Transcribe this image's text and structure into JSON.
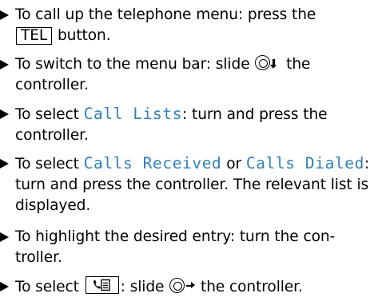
{
  "steps": [
    {
      "prefix": "To call up the telephone menu: press the ",
      "button_label": "TEL",
      "suffix": " button."
    },
    {
      "prefix": "To switch to the menu bar: slide ",
      "control_icon": "controller-slide-down-icon",
      "suffix": " the controller."
    },
    {
      "prefix": "To select ",
      "menu_item": "Call Lists",
      "suffix": ": turn and press the controller."
    },
    {
      "prefix": "To select ",
      "menu_item_1": "Calls Received",
      "middle": " or ",
      "menu_item_2": "Calls Dialed",
      "suffix": ": turn and press the controller. The relevant list is displayed."
    },
    {
      "text": "To highlight the desired entry: turn the con-troller."
    },
    {
      "prefix": "To select ",
      "symbol_icon": "phonebook-entry-icon",
      "middle": ": slide ",
      "control_icon": "controller-slide-right-icon",
      "suffix": " the controller."
    }
  ],
  "colors": {
    "text": "#000000",
    "display_text": "#2f7fb8",
    "background": "#ffffff"
  }
}
